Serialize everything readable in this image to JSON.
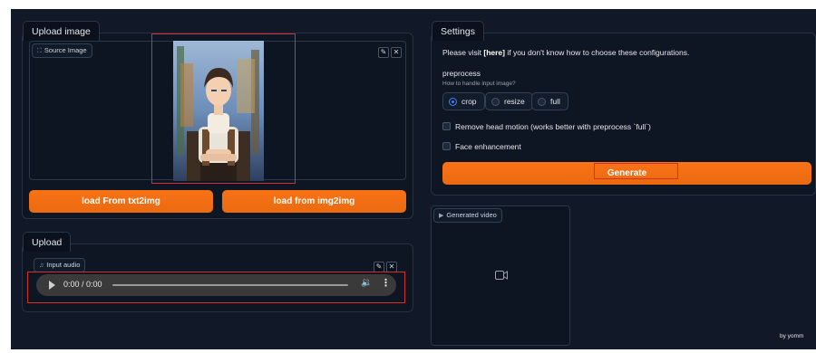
{
  "upload_image": {
    "tab_label": "Upload image",
    "source_chip": "Source Image",
    "edit_icon": "pencil-icon",
    "close_icon": "close-icon",
    "load_txt2img_label": "load From txt2img",
    "load_img2img_label": "load from img2img"
  },
  "upload": {
    "tab_label": "Upload",
    "audio_chip": "Input audio",
    "time_text": "0:00 / 0:00",
    "play_icon": "play-icon",
    "volume_icon": "volume-icon",
    "more_icon": "more-vertical-icon"
  },
  "settings": {
    "tab_label": "Settings",
    "help_prefix": "Please visit ",
    "help_link": "[here]",
    "help_suffix": " if you don't know how to choose these configurations.",
    "preprocess_label": "preprocess",
    "preprocess_hint": "How to handle input image?",
    "options": [
      "crop",
      "resize",
      "full"
    ],
    "selected_option": "crop",
    "still_mode_label": "Remove head motion (works better with preprocess `full`)",
    "enhancer_label": "Face enhancement",
    "generate_label": "Generate"
  },
  "output": {
    "video_chip": "Generated video",
    "video_icon": "video-camera-icon"
  },
  "footer": {
    "credit": "by yomm"
  },
  "colors": {
    "accent": "#f97316",
    "background": "#111827",
    "panel": "#0f1623",
    "radio_selected": "#3b82f6",
    "annotation_box": "#d32f2f"
  }
}
